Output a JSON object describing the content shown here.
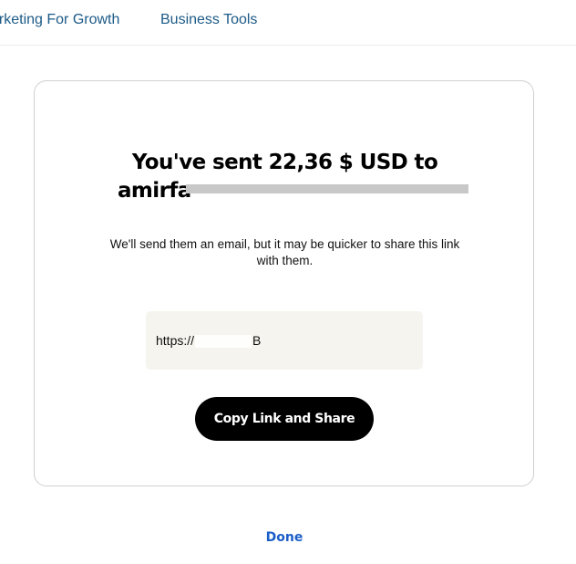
{
  "nav": {
    "items": [
      {
        "label": "arketing For Growth"
      },
      {
        "label": "Business Tools"
      }
    ]
  },
  "card": {
    "headline_line1": "You've sent 22,36 $ USD to",
    "headline_line2_visible": "amirfa",
    "subtext": "We'll send them an email, but it may be quicker to share this link with them.",
    "link_prefix": "https://",
    "link_suffix": "B",
    "copy_button_label": "Copy Link and Share"
  },
  "done_label": "Done",
  "colors": {
    "nav_link": "#1c5a87",
    "link_box_bg": "#f5f4ee",
    "button_bg": "#000000",
    "done_link": "#1a5ec8"
  }
}
